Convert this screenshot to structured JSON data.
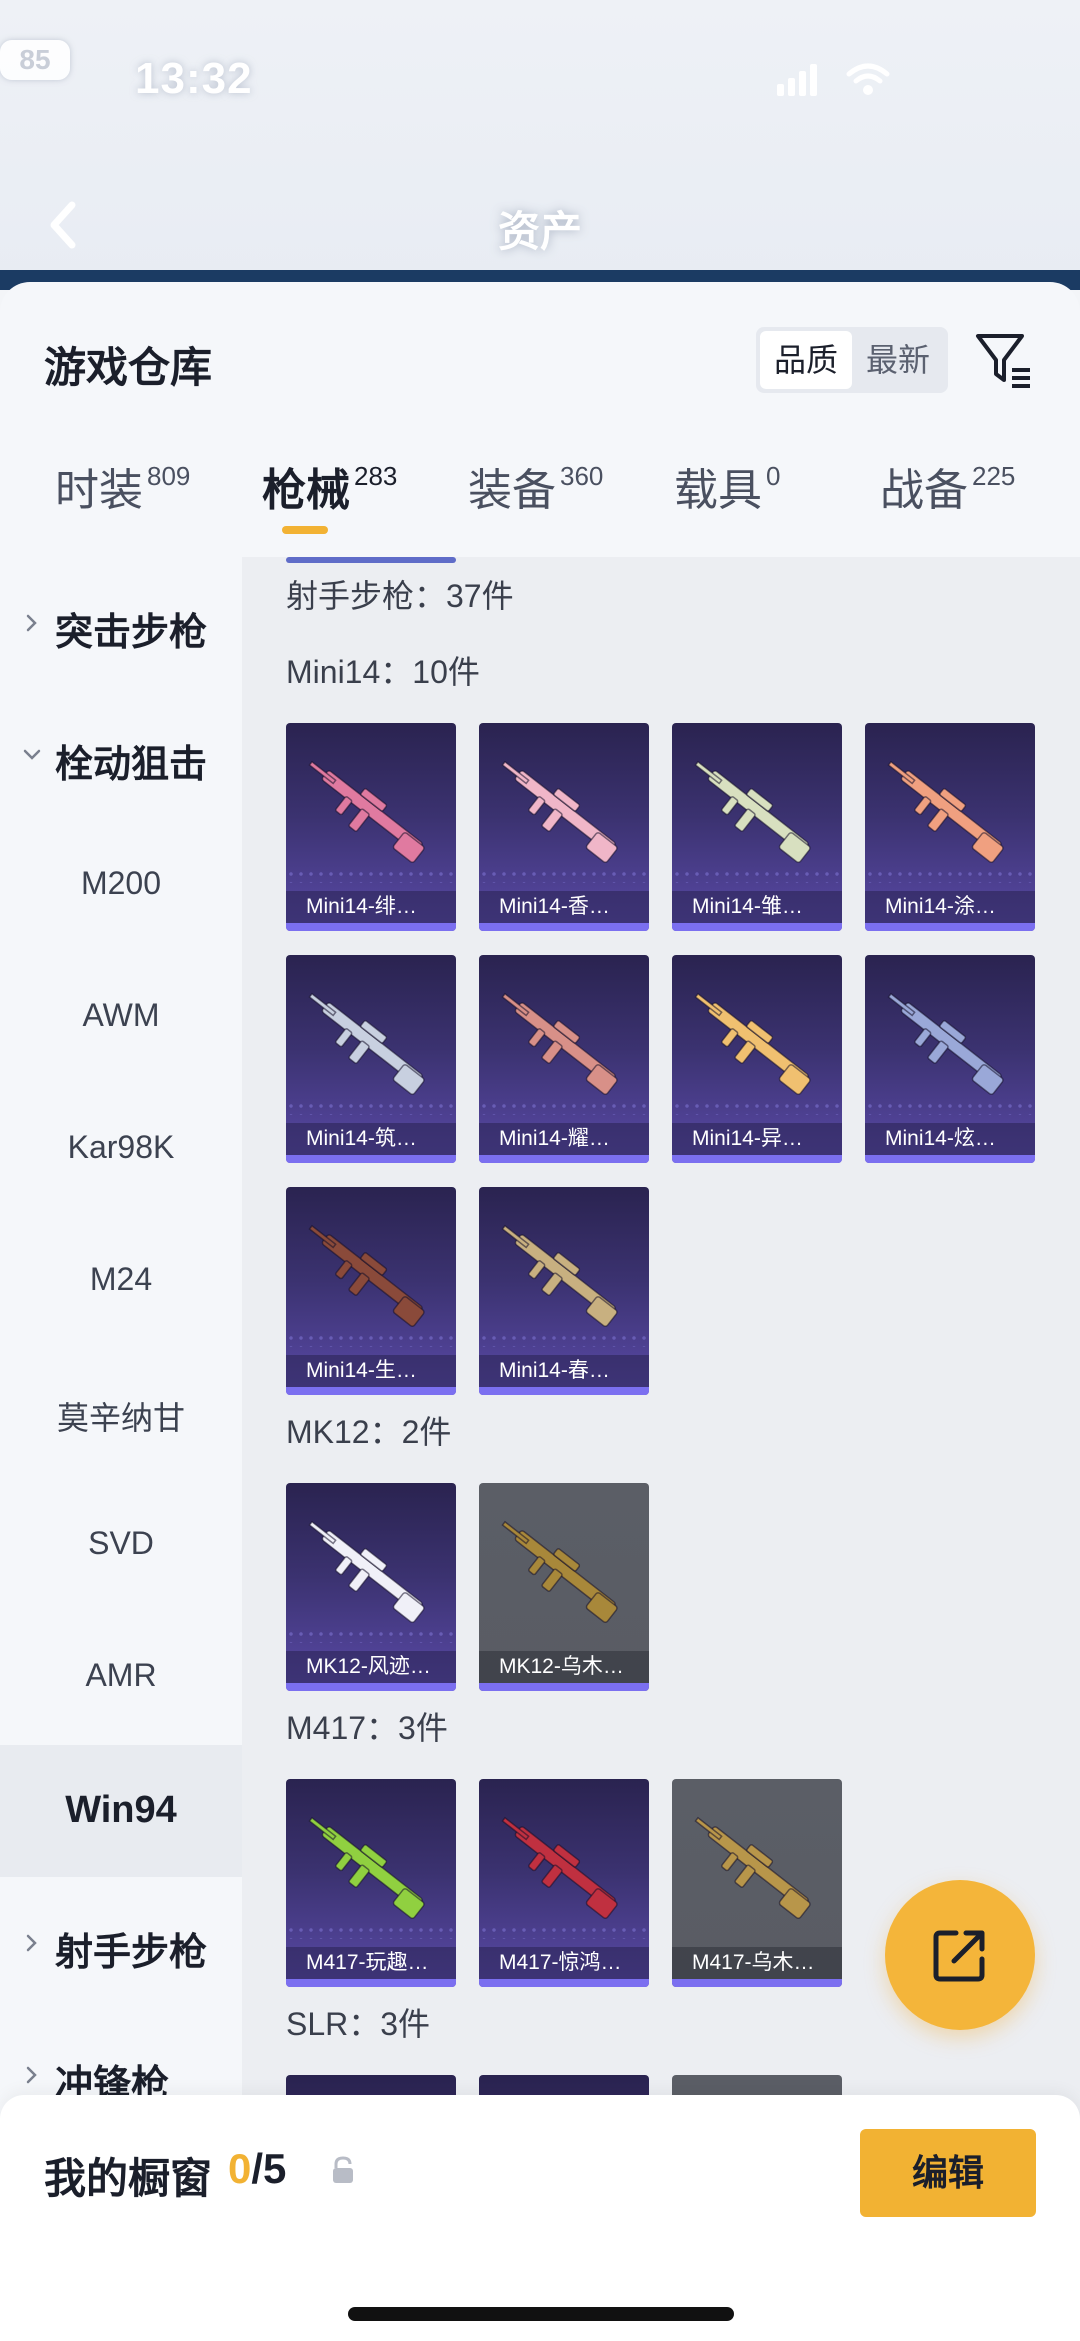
{
  "status_bar": {
    "time": "13:32",
    "battery": "85"
  },
  "nav": {
    "title": "资产",
    "back_icon": "chevron-left-icon"
  },
  "header": {
    "title": "游戏仓库",
    "sort_options": [
      "品质",
      "最新"
    ],
    "sort_selected": "品质",
    "filter_icon": "filter-icon"
  },
  "tabs": [
    {
      "label": "时装",
      "count": "809",
      "active": false
    },
    {
      "label": "枪械",
      "count": "283",
      "active": true
    },
    {
      "label": "装备",
      "count": "360",
      "active": false
    },
    {
      "label": "载具",
      "count": "0",
      "active": false
    },
    {
      "label": "战备",
      "count": "225",
      "active": false
    }
  ],
  "sidebar": [
    {
      "label": "突击步枪",
      "type": "group",
      "expanded": false
    },
    {
      "label": "栓动狙击",
      "type": "group",
      "expanded": true
    },
    {
      "label": "M200",
      "type": "sub"
    },
    {
      "label": "AWM",
      "type": "sub"
    },
    {
      "label": "Kar98K",
      "type": "sub"
    },
    {
      "label": "M24",
      "type": "sub"
    },
    {
      "label": "莫辛纳甘",
      "type": "sub"
    },
    {
      "label": "SVD",
      "type": "sub"
    },
    {
      "label": "AMR",
      "type": "sub"
    },
    {
      "label": "Win94",
      "type": "sub",
      "active": true
    },
    {
      "label": "射手步枪",
      "type": "group",
      "expanded": false
    },
    {
      "label": "冲锋枪",
      "type": "group",
      "expanded": false
    }
  ],
  "sections": [
    {
      "title": "射手步枪：37件",
      "items": []
    },
    {
      "title": "Mini14：10件",
      "items": [
        {
          "name": "Mini14-绯…",
          "color": "#e07aa0",
          "grey": false
        },
        {
          "name": "Mini14-香…",
          "color": "#f0b6c8",
          "grey": false
        },
        {
          "name": "Mini14-雏…",
          "color": "#d8e0c0",
          "grey": false
        },
        {
          "name": "Mini14-涂…",
          "color": "#f0a080",
          "grey": false
        },
        {
          "name": "Mini14-筑…",
          "color": "#c8d0e0",
          "grey": false
        },
        {
          "name": "Mini14-耀…",
          "color": "#d89088",
          "grey": false
        },
        {
          "name": "Mini14-异…",
          "color": "#f0c070",
          "grey": false
        },
        {
          "name": "Mini14-炫…",
          "color": "#9aa8d8",
          "grey": false
        },
        {
          "name": "Mini14-生…",
          "color": "#8a4a3a",
          "grey": false
        },
        {
          "name": "Mini14-春…",
          "color": "#c8b080",
          "grey": false
        }
      ]
    },
    {
      "title": "MK12：2件",
      "items": [
        {
          "name": "MK12-风迹…",
          "color": "#f0f0f8",
          "grey": false
        },
        {
          "name": "MK12-乌木…",
          "color": "#a8883a",
          "grey": true
        }
      ]
    },
    {
      "title": "M417：3件",
      "items": [
        {
          "name": "M417-玩趣…",
          "color": "#90d040",
          "grey": false
        },
        {
          "name": "M417-惊鸿…",
          "color": "#c03040",
          "grey": false
        },
        {
          "name": "M417-乌木…",
          "color": "#b8964a",
          "grey": true
        }
      ]
    },
    {
      "title": "SLR：3件",
      "items": [
        {
          "name": "",
          "color": "#8888aa",
          "grey": false
        },
        {
          "name": "",
          "color": "#8888aa",
          "grey": false
        },
        {
          "name": "",
          "color": "#8888aa",
          "grey": true
        }
      ]
    }
  ],
  "fab": {
    "icon": "share-icon"
  },
  "bottom": {
    "title": "我的橱窗",
    "count_current": "0",
    "count_total": "/5",
    "lock_icon": "lock-icon",
    "edit_label": "编辑"
  }
}
